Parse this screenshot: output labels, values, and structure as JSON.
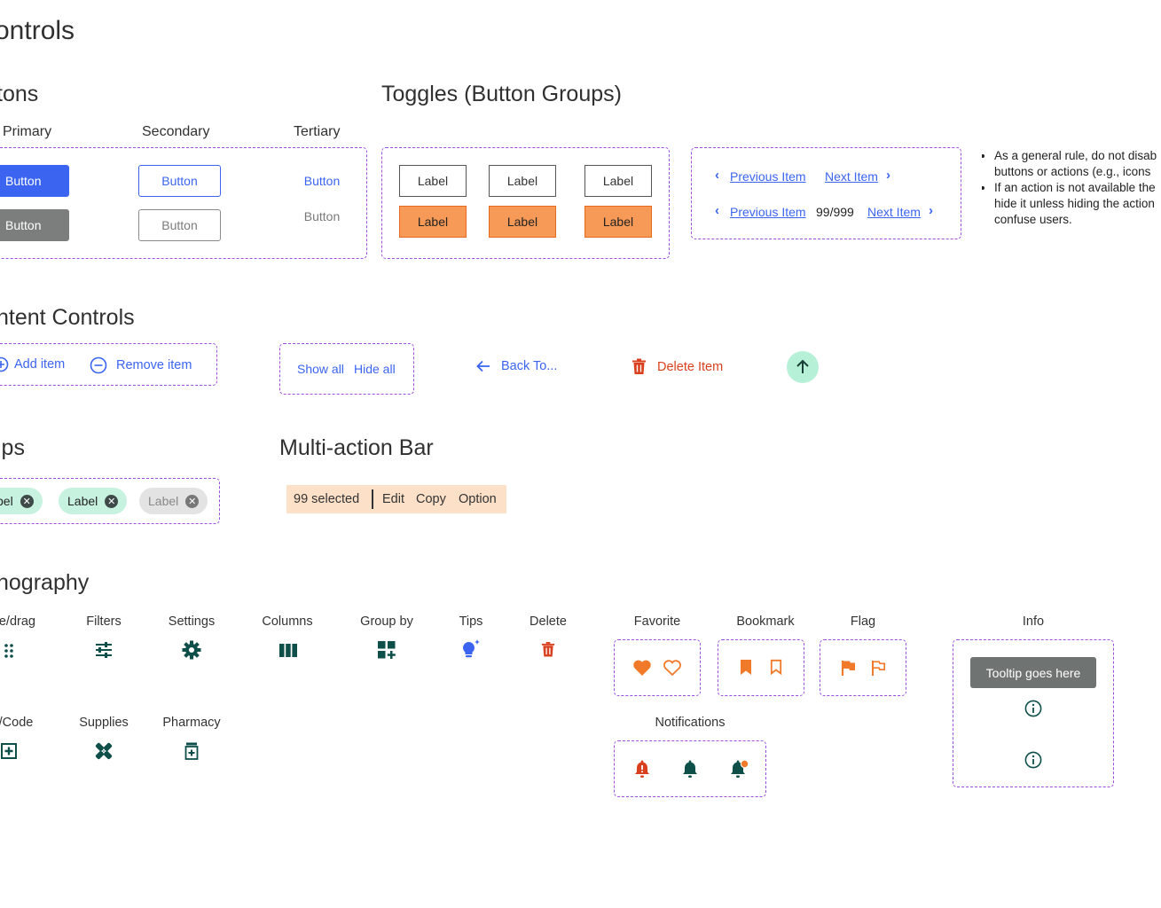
{
  "page_title": "ontrols",
  "buttons": {
    "heading": "tons",
    "col_primary": "Primary",
    "col_secondary": "Secondary",
    "col_tertiary": "Tertiary",
    "label": "Button"
  },
  "toggles": {
    "heading": "Toggles (Button Groups)",
    "label": "Label"
  },
  "pagination": {
    "previous": "Previous Item",
    "next": "Next Item",
    "count": "99/999"
  },
  "notes": [
    "As a general rule, do not disab buttons or actions (e.g., icons",
    "If an action is not available the hide it unless hiding the action confuse users."
  ],
  "content_controls": {
    "heading": "ntent Controls",
    "add_item": "Add item",
    "remove_item": "Remove item",
    "show_all": "Show all",
    "hide_all": "Hide all",
    "back_to": "Back To...",
    "delete_item": "Delete Item"
  },
  "chips": {
    "heading": "ips",
    "chip1": "bel",
    "chip2": "Label",
    "chip3": "Label"
  },
  "multi_action": {
    "heading": "Multi-action Bar",
    "selected": "99 selected",
    "edit": "Edit",
    "copy": "Copy",
    "option": "Option"
  },
  "iconography": {
    "heading": "nography",
    "move_drag": "re/drag",
    "filters": "Filters",
    "settings": "Settings",
    "columns": "Columns",
    "group_by": "Group by",
    "tips": "Tips",
    "delete": "Delete",
    "favorite": "Favorite",
    "bookmark": "Bookmark",
    "flag": "Flag",
    "info": "Info",
    "tooltip": "Tooltip goes here",
    "code": "/Code",
    "supplies": "Supplies",
    "pharmacy": "Pharmacy",
    "notifications": "Notifications"
  },
  "colors": {
    "primary_blue": "#3b64f0",
    "orange": "#f07a2a",
    "dark_teal": "#0f4f4a",
    "purple_dash": "#9b4dde",
    "red": "#d9411e"
  }
}
